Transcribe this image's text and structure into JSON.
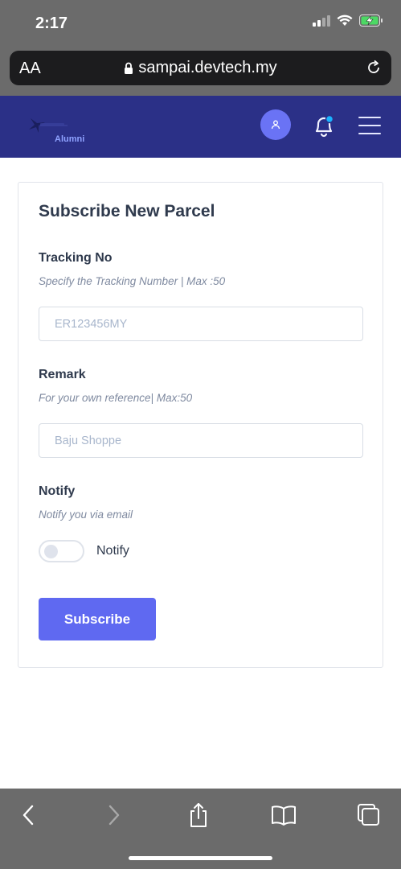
{
  "status_bar": {
    "time": "2:17"
  },
  "browser": {
    "text_size_label": "AA",
    "url": "sampai.devtech.my"
  },
  "header": {
    "logo_subtitle": "Alumni",
    "colors": {
      "background": "#2b3087",
      "avatar": "#6a73f5",
      "badge": "#1ab3ff"
    }
  },
  "form": {
    "title": "Subscribe New Parcel",
    "tracking": {
      "label": "Tracking No",
      "hint": "Specify the Tracking Number | Max :50",
      "placeholder": "ER123456MY"
    },
    "remark": {
      "label": "Remark",
      "hint": "For your own reference| Max:50",
      "placeholder": "Baju Shoppe"
    },
    "notify": {
      "label": "Notify",
      "hint": "Notify you via email",
      "toggle_label": "Notify",
      "checked": false
    },
    "submit_label": "Subscribe",
    "accent_color": "#5f69f1"
  },
  "toolbar": {
    "icons": [
      "back-icon",
      "forward-icon",
      "share-icon",
      "bookmarks-icon",
      "tabs-icon"
    ]
  }
}
